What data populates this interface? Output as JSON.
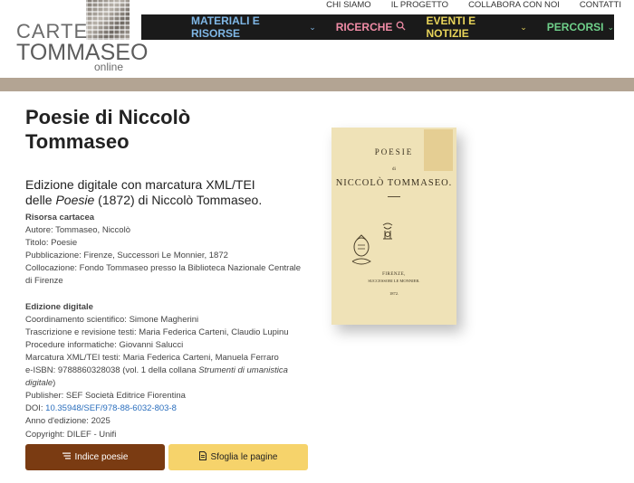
{
  "brand": {
    "line1": "CARTE",
    "line2": "TOMMASEO",
    "line3": "online"
  },
  "top_links": [
    "CHI SIAMO",
    "IL PROGETTO",
    "COLLABORA CON NOI",
    "CONTATTI"
  ],
  "main_nav": [
    {
      "label": "MATERIALI E RISORSE",
      "color": "#7fb7e6"
    },
    {
      "label": "RICERCHE",
      "color": "#f08ca6"
    },
    {
      "label": "EVENTI E NOTIZIE",
      "color": "#e8d45a"
    },
    {
      "label": "PERCORSI",
      "color": "#6fd08a"
    }
  ],
  "page": {
    "title_line1": "Poesie di Niccolò",
    "title_line2": "Tommaseo",
    "subtitle_pre": "Edizione digitale con marcatura XML/TEI",
    "subtitle_l2_a": "delle ",
    "subtitle_l2_em": "Poesie",
    "subtitle_l2_b": " (1872) di Niccolò Tommaseo."
  },
  "print_resource": {
    "heading": "Risorsa cartacea",
    "author": "Autore: Tommaseo, Niccolò",
    "title": "Titolo: Poesie",
    "publication": "Pubblicazione: Firenze, Successori Le Monnier, 1872",
    "location_1": "Collocazione: Fondo Tommaseo presso la Biblioteca Nazionale Centrale",
    "location_2": "di Firenze"
  },
  "digital_edition": {
    "heading": "Edizione digitale",
    "coordination": "Coordinamento scientifico: Simone Magherini",
    "transcription": "Trascrizione e revisione testi: Maria Federica Carteni, Claudio Lupinu",
    "procedures": "Procedure informatiche: Giovanni Salucci",
    "markup": "Marcatura XML/TEI testi: Maria Federica Carteni, Manuela Ferraro",
    "eisbn_a": "e-ISBN:  9788860328038 (vol. 1 della collana ",
    "eisbn_em1": "Strumenti di umanistica",
    "eisbn_em2": "digitale",
    "eisbn_b": ")",
    "publisher": "Publisher: SEF Società Editrice Fiorentina",
    "doi_label": "DOI: ",
    "doi_link": "10.35948/SEF/978-88-6032-803-8",
    "year": "Anno d'edizione: 2025",
    "copyright": "Copyright: DILEF - Unifi"
  },
  "buttons": {
    "index_label": "Indice poesie",
    "index_color": "#7a3b12",
    "browse_label": "Sfoglia le pagine",
    "browse_color": "#f6d36b"
  },
  "cover": {
    "title": "POESIE",
    "di": "di",
    "author": "NICCOLÒ TOMMASEO.",
    "city": "FIRENZE,",
    "publisher": "SUCCESSORI LE MONNIER.",
    "year": "1872."
  }
}
